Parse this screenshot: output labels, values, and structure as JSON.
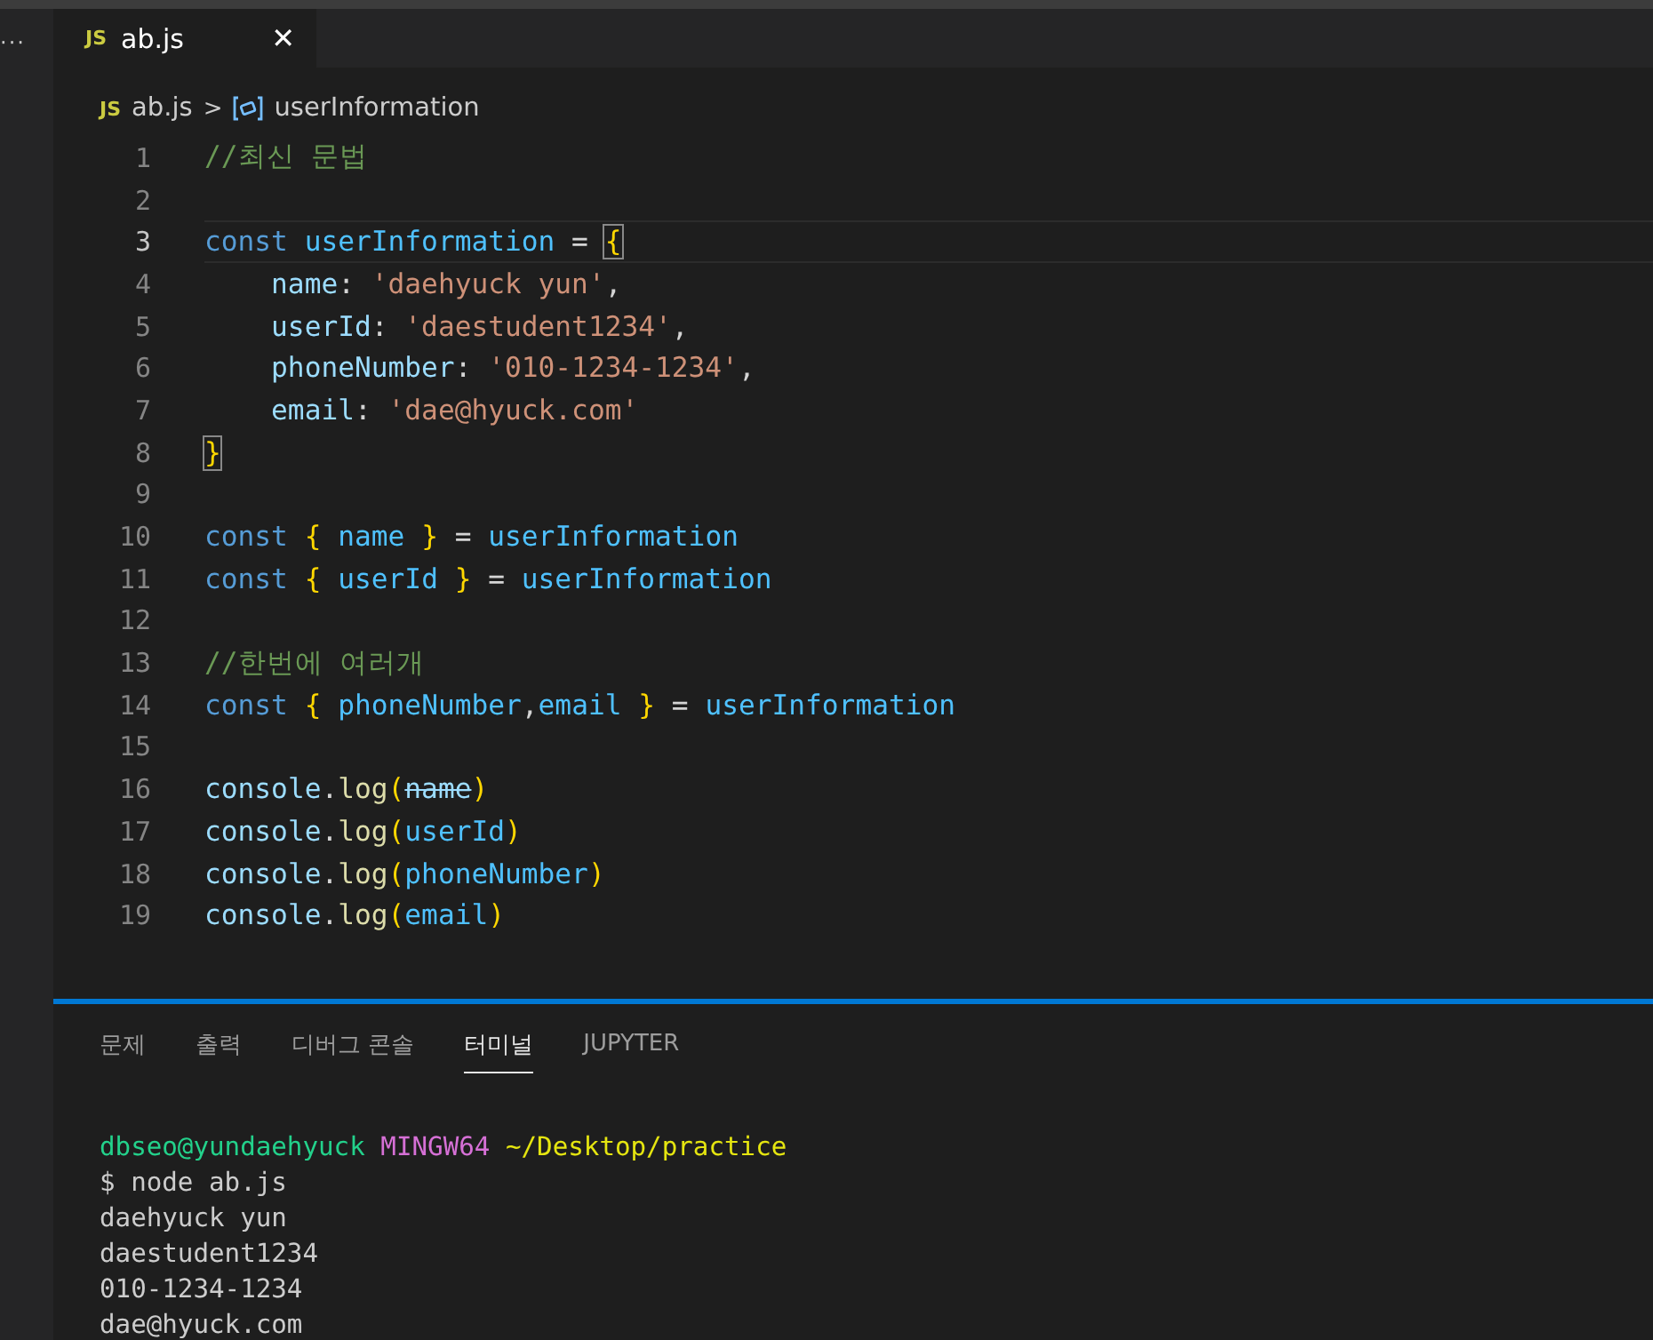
{
  "activity_bar": {
    "more": "···"
  },
  "tabs": [
    {
      "icon": "JS",
      "label": "ab.js",
      "close": "✕",
      "selected": true
    }
  ],
  "breadcrumb": {
    "icon": "JS",
    "file": "ab.js",
    "separator": ">",
    "symbol": "userInformation"
  },
  "editor": {
    "lines": [
      {
        "number": "1",
        "current": false,
        "tokens": [
          {
            "kind": "comment",
            "text": "//최신 문법"
          }
        ]
      },
      {
        "number": "2",
        "current": false
      },
      {
        "number": "3",
        "current": true,
        "tokens": [
          {
            "kind": "keyword",
            "text": "const "
          },
          {
            "kind": "variable",
            "text": "userInformation"
          },
          {
            "kind": "plain",
            "text": " = "
          },
          {
            "kind": "bracket-match",
            "text": "{"
          }
        ]
      },
      {
        "number": "4",
        "current": false,
        "indent": true,
        "tokens": [
          {
            "kind": "property",
            "text": "name"
          },
          {
            "kind": "plain",
            "text": ": "
          },
          {
            "kind": "string",
            "text": "'daehyuck yun'"
          },
          {
            "kind": "plain",
            "text": ","
          }
        ]
      },
      {
        "number": "5",
        "current": false,
        "indent": true,
        "tokens": [
          {
            "kind": "property",
            "text": "userId"
          },
          {
            "kind": "plain",
            "text": ": "
          },
          {
            "kind": "string",
            "text": "'daestudent1234'"
          },
          {
            "kind": "plain",
            "text": ","
          }
        ]
      },
      {
        "number": "6",
        "current": false,
        "indent": true,
        "tokens": [
          {
            "kind": "property",
            "text": "phoneNumber"
          },
          {
            "kind": "plain",
            "text": ": "
          },
          {
            "kind": "string",
            "text": "'010-1234-1234'"
          },
          {
            "kind": "plain",
            "text": ","
          }
        ]
      },
      {
        "number": "7",
        "current": false,
        "indent": true,
        "tokens": [
          {
            "kind": "property",
            "text": "email"
          },
          {
            "kind": "plain",
            "text": ": "
          },
          {
            "kind": "string",
            "text": "'dae@hyuck.com'"
          }
        ]
      },
      {
        "number": "8",
        "current": false,
        "tokens": [
          {
            "kind": "bracket-match",
            "text": "}"
          }
        ]
      },
      {
        "number": "9",
        "current": false
      },
      {
        "number": "10",
        "current": false,
        "tokens": [
          {
            "kind": "keyword",
            "text": "const "
          },
          {
            "kind": "brace",
            "text": "{"
          },
          {
            "kind": "variable",
            "text": " name "
          },
          {
            "kind": "brace",
            "text": "}"
          },
          {
            "kind": "plain",
            "text": " = "
          },
          {
            "kind": "variable",
            "text": "userInformation"
          }
        ]
      },
      {
        "number": "11",
        "current": false,
        "tokens": [
          {
            "kind": "keyword",
            "text": "const "
          },
          {
            "kind": "brace",
            "text": "{"
          },
          {
            "kind": "variable",
            "text": " userId "
          },
          {
            "kind": "brace",
            "text": "}"
          },
          {
            "kind": "plain",
            "text": " = "
          },
          {
            "kind": "variable",
            "text": "userInformation"
          }
        ]
      },
      {
        "number": "12",
        "current": false
      },
      {
        "number": "13",
        "current": false,
        "tokens": [
          {
            "kind": "comment",
            "text": "//한번에 여러개"
          }
        ]
      },
      {
        "number": "14",
        "current": false,
        "tokens": [
          {
            "kind": "keyword",
            "text": "const "
          },
          {
            "kind": "brace",
            "text": "{"
          },
          {
            "kind": "variable",
            "text": " phoneNumber"
          },
          {
            "kind": "plain",
            "text": ","
          },
          {
            "kind": "variable",
            "text": "email "
          },
          {
            "kind": "brace",
            "text": "}"
          },
          {
            "kind": "plain",
            "text": " = "
          },
          {
            "kind": "variable",
            "text": "userInformation"
          }
        ]
      },
      {
        "number": "15",
        "current": false
      },
      {
        "number": "16",
        "current": false,
        "tokens": [
          {
            "kind": "property",
            "text": "console"
          },
          {
            "kind": "plain",
            "text": "."
          },
          {
            "kind": "function",
            "text": "log"
          },
          {
            "kind": "brace",
            "text": "("
          },
          {
            "kind": "deprecated",
            "text": "name"
          },
          {
            "kind": "brace",
            "text": ")"
          }
        ]
      },
      {
        "number": "17",
        "current": false,
        "tokens": [
          {
            "kind": "property",
            "text": "console"
          },
          {
            "kind": "plain",
            "text": "."
          },
          {
            "kind": "function",
            "text": "log"
          },
          {
            "kind": "brace",
            "text": "("
          },
          {
            "kind": "variable",
            "text": "userId"
          },
          {
            "kind": "brace",
            "text": ")"
          }
        ]
      },
      {
        "number": "18",
        "current": false,
        "tokens": [
          {
            "kind": "property",
            "text": "console"
          },
          {
            "kind": "plain",
            "text": "."
          },
          {
            "kind": "function",
            "text": "log"
          },
          {
            "kind": "brace",
            "text": "("
          },
          {
            "kind": "variable",
            "text": "phoneNumber"
          },
          {
            "kind": "brace",
            "text": ")"
          }
        ]
      },
      {
        "number": "19",
        "current": false,
        "tokens": [
          {
            "kind": "property",
            "text": "console"
          },
          {
            "kind": "plain",
            "text": "."
          },
          {
            "kind": "function",
            "text": "log"
          },
          {
            "kind": "brace",
            "text": "("
          },
          {
            "kind": "variable",
            "text": "email"
          },
          {
            "kind": "brace",
            "text": ")"
          }
        ]
      }
    ]
  },
  "panel": {
    "tabs": [
      {
        "label": "문제",
        "selected": false
      },
      {
        "label": "출력",
        "selected": false
      },
      {
        "label": "디버그 콘솔",
        "selected": false
      },
      {
        "label": "터미널",
        "selected": true
      },
      {
        "label": "JUPYTER",
        "selected": false
      }
    ],
    "terminal": {
      "prompt": {
        "user": "dbseo@yundaehyuck",
        "system": "MINGW64",
        "path": "~/Desktop/practice"
      },
      "lines": [
        "$ node ab.js",
        "daehyuck yun",
        "daestudent1234",
        "010-1234-1234",
        "dae@hyuck.com"
      ]
    }
  }
}
